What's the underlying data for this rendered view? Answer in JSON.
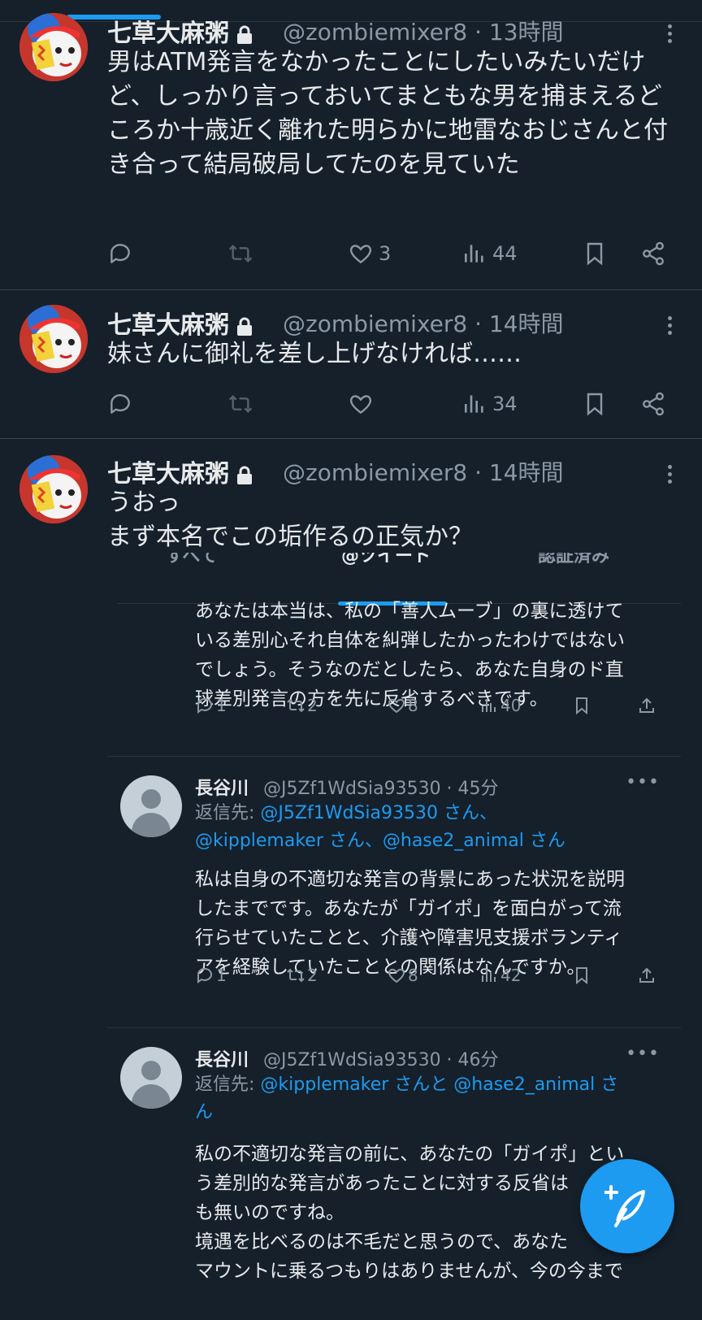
{
  "tweets": [
    {
      "display_name": "七草大麻粥",
      "handle_time": "@zombiemixer8 · 13時間",
      "text": "男はATM発言をなかったことにしたいみたいだけど、しっかり言っておいてまともな男を捕まえるどころか十歳近く離れた明らかに地雷なおじさんと付き合って結局破局してたのを見ていた",
      "likes": "3",
      "views": "44"
    },
    {
      "display_name": "七草大麻粥",
      "handle_time": "@zombiemixer8 · 14時間",
      "text": "妹さんに御礼を差し上げなければ……",
      "likes": "",
      "views": "34"
    },
    {
      "display_name": "七草大麻粥",
      "handle_time": "@zombiemixer8 · 14時間",
      "line1": "うおっ",
      "line2": "まず本名でこの垢作るの正気か？"
    }
  ],
  "embed": {
    "tabs": [
      "すべて",
      "@ツイート",
      "認証済み"
    ],
    "top_text": [
      "あなたは本当は、私の「善人ムーブ」の裏に透けて",
      "いる差別心それ自体を糾弾したかったわけではない",
      "でしょう。そうなのだとしたら、あなた自身のド直",
      "球差別発言の方を先に反省するべきです。"
    ],
    "top_stats": {
      "replies": "1",
      "retweets": "2",
      "likes": "8",
      "views": "40"
    },
    "reply1": {
      "name": "長谷川",
      "handle_time": "@J5Zf1WdSia93530 · 45分",
      "reply_prefix": "返信先: ",
      "reply_line1_link": "@J5Zf1WdSia93530 さん、",
      "reply_line2_link": "@kipplemaker さん、@hase2_animal さん",
      "text": [
        "私は自身の不適切な発言の背景にあった状況を説明",
        "したまでです。あなたが「ガイポ」を面白がって流",
        "行らせていたことと、介護や障害児支援ボランティ",
        "アを経験していたこととの関係はなんですか。"
      ],
      "stats": {
        "replies": "1",
        "retweets": "2",
        "likes": "8",
        "views": "42"
      }
    },
    "reply2": {
      "name": "長谷川",
      "handle_time": "@J5Zf1WdSia93530 · 46分",
      "reply_prefix": "返信先: ",
      "reply_line1_link": "@kipplemaker さんと @hase2_animal さ",
      "reply_line2_link": "ん",
      "text": [
        "私の不適切な発言の前に、あなたの「ガイポ」とい",
        "う差別的な発言があったことに対する反省は",
        "も無いのですね。",
        "境遇を比べるのは不毛だと思うので、あなた",
        "マウントに乗るつもりはありませんが、今の今まで"
      ]
    }
  },
  "colors": {
    "background": "#15202b",
    "accent": "#1d9bf0",
    "muted": "#8b98a5",
    "text": "#e7e9ea"
  }
}
